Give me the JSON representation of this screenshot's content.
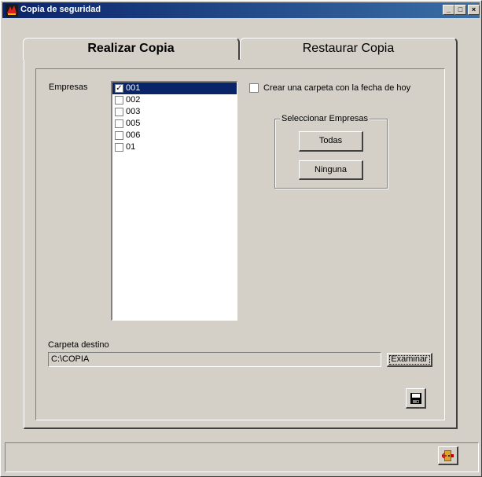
{
  "window": {
    "title": "Copia de seguridad",
    "controls": {
      "minimize": "_",
      "maximize": "□",
      "close": "×"
    }
  },
  "tabs": [
    {
      "label": "Realizar Copia",
      "active": true
    },
    {
      "label": "Restaurar Copia",
      "active": false
    }
  ],
  "empresas": {
    "label": "Empresas",
    "items": [
      {
        "label": "001",
        "checked": true,
        "selected": true
      },
      {
        "label": "002",
        "checked": false,
        "selected": false
      },
      {
        "label": "003",
        "checked": false,
        "selected": false
      },
      {
        "label": "005",
        "checked": false,
        "selected": false
      },
      {
        "label": "006",
        "checked": false,
        "selected": false
      },
      {
        "label": "01",
        "checked": false,
        "selected": false
      }
    ]
  },
  "options": {
    "crear_carpeta_label": "Crear una carpeta con la fecha de hoy",
    "crear_carpeta_checked": false
  },
  "seleccionar": {
    "legend": "Seleccionar Empresas",
    "todas_label": "Todas",
    "ninguna_label": "Ninguna"
  },
  "destino": {
    "label": "Carpeta destino",
    "value": "C:\\COPIA",
    "examinar_label": "Examinar"
  },
  "icons": {
    "app": "app-logo-icon",
    "save": "floppy-disk-icon",
    "exit": "exit-door-icon"
  },
  "colors": {
    "titlebar": "#0a246a",
    "selection": "#0a246a",
    "face": "#d4d0c8"
  }
}
